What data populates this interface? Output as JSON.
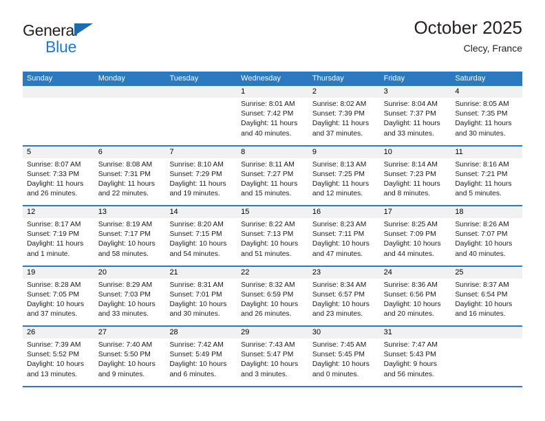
{
  "brand": {
    "name_top": "General",
    "name_bottom": "Blue",
    "flag_icon": "triangle-flag-icon",
    "accent_dark": "#1b6cb0",
    "accent_light": "#1b7ad0"
  },
  "header": {
    "title": "October 2025",
    "subtitle": "Clecy, France"
  },
  "calendar": {
    "header_color": "#2b79bf",
    "daynum_bg": "#f1f1f1",
    "day_names": [
      "Sunday",
      "Monday",
      "Tuesday",
      "Wednesday",
      "Thursday",
      "Friday",
      "Saturday"
    ],
    "weeks": [
      [
        {
          "day": "",
          "empty": true
        },
        {
          "day": "",
          "empty": true
        },
        {
          "day": "",
          "empty": true
        },
        {
          "day": "1",
          "sunrise": "Sunrise: 8:01 AM",
          "sunset": "Sunset: 7:42 PM",
          "daylight": "Daylight: 11 hours and 40 minutes."
        },
        {
          "day": "2",
          "sunrise": "Sunrise: 8:02 AM",
          "sunset": "Sunset: 7:39 PM",
          "daylight": "Daylight: 11 hours and 37 minutes."
        },
        {
          "day": "3",
          "sunrise": "Sunrise: 8:04 AM",
          "sunset": "Sunset: 7:37 PM",
          "daylight": "Daylight: 11 hours and 33 minutes."
        },
        {
          "day": "4",
          "sunrise": "Sunrise: 8:05 AM",
          "sunset": "Sunset: 7:35 PM",
          "daylight": "Daylight: 11 hours and 30 minutes."
        }
      ],
      [
        {
          "day": "5",
          "sunrise": "Sunrise: 8:07 AM",
          "sunset": "Sunset: 7:33 PM",
          "daylight": "Daylight: 11 hours and 26 minutes."
        },
        {
          "day": "6",
          "sunrise": "Sunrise: 8:08 AM",
          "sunset": "Sunset: 7:31 PM",
          "daylight": "Daylight: 11 hours and 22 minutes."
        },
        {
          "day": "7",
          "sunrise": "Sunrise: 8:10 AM",
          "sunset": "Sunset: 7:29 PM",
          "daylight": "Daylight: 11 hours and 19 minutes."
        },
        {
          "day": "8",
          "sunrise": "Sunrise: 8:11 AM",
          "sunset": "Sunset: 7:27 PM",
          "daylight": "Daylight: 11 hours and 15 minutes."
        },
        {
          "day": "9",
          "sunrise": "Sunrise: 8:13 AM",
          "sunset": "Sunset: 7:25 PM",
          "daylight": "Daylight: 11 hours and 12 minutes."
        },
        {
          "day": "10",
          "sunrise": "Sunrise: 8:14 AM",
          "sunset": "Sunset: 7:23 PM",
          "daylight": "Daylight: 11 hours and 8 minutes."
        },
        {
          "day": "11",
          "sunrise": "Sunrise: 8:16 AM",
          "sunset": "Sunset: 7:21 PM",
          "daylight": "Daylight: 11 hours and 5 minutes."
        }
      ],
      [
        {
          "day": "12",
          "sunrise": "Sunrise: 8:17 AM",
          "sunset": "Sunset: 7:19 PM",
          "daylight": "Daylight: 11 hours and 1 minute."
        },
        {
          "day": "13",
          "sunrise": "Sunrise: 8:19 AM",
          "sunset": "Sunset: 7:17 PM",
          "daylight": "Daylight: 10 hours and 58 minutes."
        },
        {
          "day": "14",
          "sunrise": "Sunrise: 8:20 AM",
          "sunset": "Sunset: 7:15 PM",
          "daylight": "Daylight: 10 hours and 54 minutes."
        },
        {
          "day": "15",
          "sunrise": "Sunrise: 8:22 AM",
          "sunset": "Sunset: 7:13 PM",
          "daylight": "Daylight: 10 hours and 51 minutes."
        },
        {
          "day": "16",
          "sunrise": "Sunrise: 8:23 AM",
          "sunset": "Sunset: 7:11 PM",
          "daylight": "Daylight: 10 hours and 47 minutes."
        },
        {
          "day": "17",
          "sunrise": "Sunrise: 8:25 AM",
          "sunset": "Sunset: 7:09 PM",
          "daylight": "Daylight: 10 hours and 44 minutes."
        },
        {
          "day": "18",
          "sunrise": "Sunrise: 8:26 AM",
          "sunset": "Sunset: 7:07 PM",
          "daylight": "Daylight: 10 hours and 40 minutes."
        }
      ],
      [
        {
          "day": "19",
          "sunrise": "Sunrise: 8:28 AM",
          "sunset": "Sunset: 7:05 PM",
          "daylight": "Daylight: 10 hours and 37 minutes."
        },
        {
          "day": "20",
          "sunrise": "Sunrise: 8:29 AM",
          "sunset": "Sunset: 7:03 PM",
          "daylight": "Daylight: 10 hours and 33 minutes."
        },
        {
          "day": "21",
          "sunrise": "Sunrise: 8:31 AM",
          "sunset": "Sunset: 7:01 PM",
          "daylight": "Daylight: 10 hours and 30 minutes."
        },
        {
          "day": "22",
          "sunrise": "Sunrise: 8:32 AM",
          "sunset": "Sunset: 6:59 PM",
          "daylight": "Daylight: 10 hours and 26 minutes."
        },
        {
          "day": "23",
          "sunrise": "Sunrise: 8:34 AM",
          "sunset": "Sunset: 6:57 PM",
          "daylight": "Daylight: 10 hours and 23 minutes."
        },
        {
          "day": "24",
          "sunrise": "Sunrise: 8:36 AM",
          "sunset": "Sunset: 6:56 PM",
          "daylight": "Daylight: 10 hours and 20 minutes."
        },
        {
          "day": "25",
          "sunrise": "Sunrise: 8:37 AM",
          "sunset": "Sunset: 6:54 PM",
          "daylight": "Daylight: 10 hours and 16 minutes."
        }
      ],
      [
        {
          "day": "26",
          "sunrise": "Sunrise: 7:39 AM",
          "sunset": "Sunset: 5:52 PM",
          "daylight": "Daylight: 10 hours and 13 minutes."
        },
        {
          "day": "27",
          "sunrise": "Sunrise: 7:40 AM",
          "sunset": "Sunset: 5:50 PM",
          "daylight": "Daylight: 10 hours and 9 minutes."
        },
        {
          "day": "28",
          "sunrise": "Sunrise: 7:42 AM",
          "sunset": "Sunset: 5:49 PM",
          "daylight": "Daylight: 10 hours and 6 minutes."
        },
        {
          "day": "29",
          "sunrise": "Sunrise: 7:43 AM",
          "sunset": "Sunset: 5:47 PM",
          "daylight": "Daylight: 10 hours and 3 minutes."
        },
        {
          "day": "30",
          "sunrise": "Sunrise: 7:45 AM",
          "sunset": "Sunset: 5:45 PM",
          "daylight": "Daylight: 10 hours and 0 minutes."
        },
        {
          "day": "31",
          "sunrise": "Sunrise: 7:47 AM",
          "sunset": "Sunset: 5:43 PM",
          "daylight": "Daylight: 9 hours and 56 minutes."
        },
        {
          "day": "",
          "empty": true
        }
      ]
    ]
  }
}
